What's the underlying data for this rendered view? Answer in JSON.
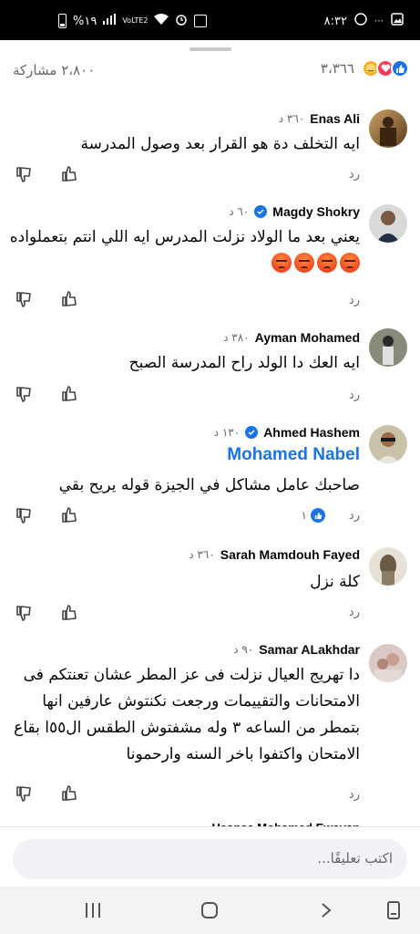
{
  "status_bar": {
    "time": "٨:٣٢",
    "battery": "%١٩",
    "network": "VoLTE2",
    "left_icons": [
      "battery-icon",
      "signal-icon",
      "lte-icon",
      "wifi-icon",
      "alarm-icon",
      "sync-icon"
    ],
    "right_icons": [
      "gallery-icon",
      "whatsapp-icon"
    ]
  },
  "reactions": {
    "count": "٣،٣٦٦",
    "shares": "٢،٨٠٠ مشاركة",
    "types": [
      "like",
      "love",
      "care"
    ]
  },
  "comments": [
    {
      "name": "Enas Ali",
      "time": "٣٦٠ د",
      "verified": false,
      "text": "ايه التخلف دة هو القرار بعد وصول المدرسة",
      "reply_label": "رد",
      "likes": ""
    },
    {
      "name": "Magdy Shokry",
      "time": "٦٠ د",
      "verified": true,
      "text": "يعني بعد ما الولاد نزلت المدرس ايه اللي انتم بتعملواده",
      "reply_label": "رد",
      "likes": ""
    },
    {
      "name": "Ayman Mohamed",
      "time": "٣٨٠ د",
      "verified": false,
      "text": "ايه العك دا الولد راح المدرسة الصبح",
      "reply_label": "رد",
      "likes": ""
    },
    {
      "name": "Ahmed Hashem",
      "time": "١٣٠ د",
      "verified": true,
      "mention": "Mohamed Nabel",
      "text": "صاحبك عامل مشاكل في الجيزة قوله يريح بقي",
      "reply_label": "رد",
      "likes": "١"
    },
    {
      "name": "Sarah Mamdouh Fayed",
      "time": "٣٦٠ د",
      "verified": false,
      "text": "كلة نزل",
      "reply_label": "رد",
      "likes": ""
    },
    {
      "name": "Samar ALakhdar",
      "time": "٩٠ د",
      "verified": false,
      "text": "دا تهريج العيال نزلت فى عز المطر عشان تعنتكم فى الامتحانات والتقييمات ورجعت نكنتوش عارفين انها بتمطر من الساعه ٣ وله مشفتوش الطقس ال٥٥ا بقاع الامتحان واكتفوا باخر السنه وارحمونا",
      "reply_label": "رد",
      "likes": ""
    }
  ],
  "partial_next": {
    "name": "Hasnaa Mohamed Ewavan"
  },
  "composer": {
    "placeholder": "اكتب تعليقًا..."
  },
  "colors": {
    "accent": "#1b74e4",
    "love": "#f33e58",
    "care": "#f7b125",
    "angry": "#f0451e"
  }
}
